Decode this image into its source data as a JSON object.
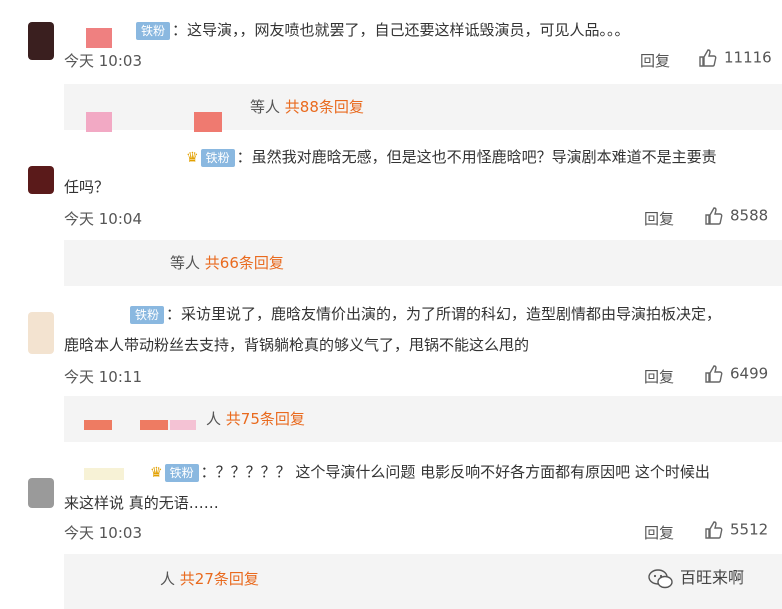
{
  "badge_label": "铁粉",
  "comments": [
    {
      "text": "：这导演，，网友喷也就罢了，自己还要这样诋毁演员，可见人品。。。",
      "time": "今天 10:03",
      "reply": "回复",
      "likes": "11116",
      "sub": {
        "name_tail": "等人",
        "count": "共88条回复"
      }
    },
    {
      "text_line1": "：虽然我对鹿晗无感，但是这也不用怪鹿晗吧？导演剧本难道不是主要责",
      "text_line2": "任吗？",
      "time": "今天 10:04",
      "reply": "回复",
      "likes": "8588",
      "sub": {
        "name_tail": "等人",
        "count": "共66条回复"
      }
    },
    {
      "text_line1": "：采访里说了，鹿晗友情价出演的，为了所谓的科幻，造型剧情都由导演拍板决定，",
      "text_line2": "鹿晗本人带动粉丝去支持，背锅躺枪真的够义气了，甩锅不能这么甩的",
      "time": "今天 10:11",
      "reply": "回复",
      "likes": "6499",
      "sub": {
        "name_tail": "人",
        "count": "共75条回复"
      }
    },
    {
      "text_line1": "：？？？？？ 这个导演什么问题 电影反响不好各方面都有原因吧 这个时候出",
      "text_line2": "来这样说 真的无语……",
      "time": "今天 10:03",
      "reply": "回复",
      "likes": "5512",
      "sub": {
        "name_tail": "人",
        "count": "共27条回复"
      }
    }
  ],
  "watermark": "百旺来啊",
  "colors": {
    "accent": "#e96a1e",
    "badge": "#8ab8e0",
    "sub_bg": "#f4f4f4"
  }
}
